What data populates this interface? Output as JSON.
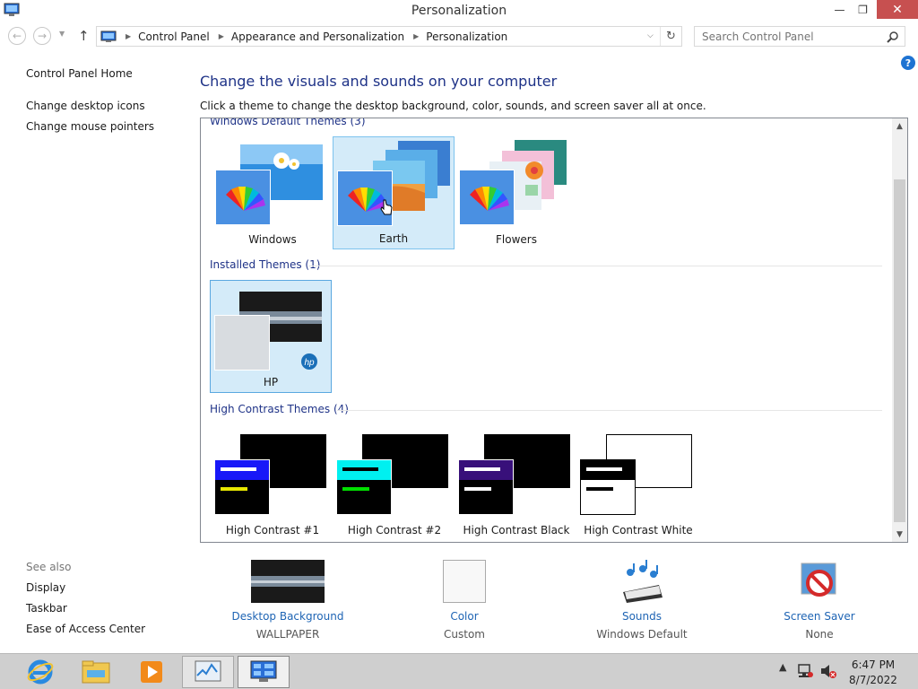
{
  "window": {
    "title": "Personalization",
    "minimize": "—",
    "maximize": "❐",
    "close": "✕"
  },
  "address": {
    "crumbs": [
      "Control Panel",
      "Appearance and Personalization",
      "Personalization"
    ],
    "search_placeholder": "Search Control Panel"
  },
  "sidebar": {
    "home": "Control Panel Home",
    "tasks": [
      "Change desktop icons",
      "Change mouse pointers"
    ],
    "see_also_label": "See also",
    "see_also": [
      "Display",
      "Taskbar",
      "Ease of Access Center"
    ]
  },
  "main": {
    "heading": "Change the visuals and sounds on your computer",
    "subheading": "Click a theme to change the desktop background, color, sounds, and screen saver all at once."
  },
  "themes": {
    "groups": [
      {
        "title": "Windows Default Themes (3)",
        "items": [
          {
            "name": "Windows",
            "selected": false
          },
          {
            "name": "Earth",
            "selected": false,
            "hovered": true
          },
          {
            "name": "Flowers",
            "selected": false
          }
        ]
      },
      {
        "title": "Installed Themes (1)",
        "items": [
          {
            "name": "HP",
            "selected": true
          }
        ]
      },
      {
        "title": "High Contrast Themes (4)",
        "items": [
          {
            "name": "High Contrast #1",
            "selected": false
          },
          {
            "name": "High Contrast #2",
            "selected": false
          },
          {
            "name": "High Contrast Black",
            "selected": false
          },
          {
            "name": "High Contrast White",
            "selected": false
          }
        ]
      }
    ]
  },
  "settings": [
    {
      "title": "Desktop Background",
      "value": "WALLPAPER"
    },
    {
      "title": "Color",
      "value": "Custom"
    },
    {
      "title": "Sounds",
      "value": "Windows Default"
    },
    {
      "title": "Screen Saver",
      "value": "None"
    }
  ],
  "taskbar": {
    "apps": [
      "internet-explorer",
      "file-explorer",
      "media-player",
      "task-manager",
      "control-panel"
    ],
    "time": "6:47 PM",
    "date": "8/7/2022"
  },
  "colors": {
    "accent_text": "#1e3287",
    "link": "#1e64b4",
    "selection": "#d4ebf9"
  }
}
